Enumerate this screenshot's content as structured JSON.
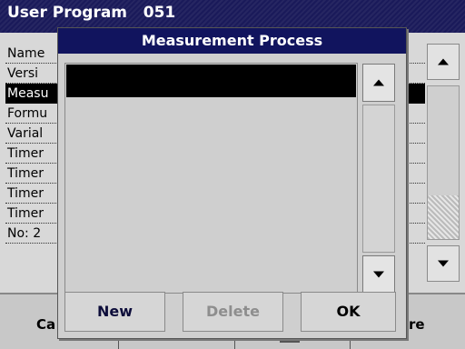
{
  "background": {
    "title": "User Program   051",
    "rows": [
      "Name",
      "Versi",
      "Measu",
      "Formu",
      "Varial",
      "Timer",
      "Timer",
      "Timer",
      "Timer",
      "No: 2"
    ],
    "selected_row_index": 2,
    "bottom_left_button": "Ca",
    "bottom_right_button": "re"
  },
  "dialog": {
    "title": "Measurement Process",
    "list_items": [
      ""
    ],
    "selected_item_index": 0,
    "buttons": {
      "new": "New",
      "delete": "Delete",
      "ok": "OK"
    },
    "delete_enabled": false
  },
  "colors": {
    "title_bar": "#11145e",
    "selection": "#000000",
    "disabled_text": "#8e8e8e"
  }
}
